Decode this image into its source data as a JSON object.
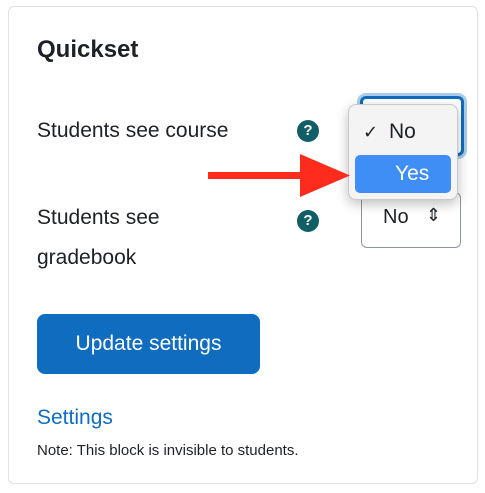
{
  "block": {
    "title": "Quickset",
    "course_label": "Students see course",
    "gradebook_label_line1": "Students see",
    "gradebook_label_line2": "gradebook",
    "help_glyph": "?",
    "course_select": {
      "current_value": "Yes",
      "options": [
        {
          "label": "No",
          "checked": true,
          "highlighted": false
        },
        {
          "label": "Yes",
          "checked": false,
          "highlighted": true
        }
      ]
    },
    "gradebook_select": {
      "value": "No",
      "arrow_glyph": "⇕"
    },
    "update_button_label": "Update settings",
    "settings_link_label": "Settings",
    "note_text": "Note: This block is invisible to students."
  },
  "colors": {
    "primary": "#0f6cbf",
    "help_icon": "#115e67",
    "dropdown_highlight": "#3f8ef5",
    "annotation_arrow": "#ff2b1c"
  },
  "icons": {
    "help": "question-circle-icon",
    "check": "checkmark-icon",
    "select_arrow": "updown-chevron-icon",
    "annotation": "red-arrow-icon"
  }
}
